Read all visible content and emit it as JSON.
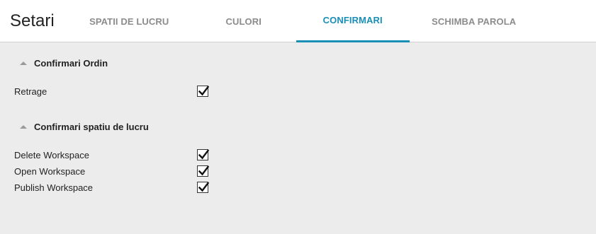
{
  "app": {
    "title": "Setari"
  },
  "tabs": [
    {
      "label": "SPATII DE LUCRU",
      "active": false
    },
    {
      "label": "CULORI",
      "active": false
    },
    {
      "label": "CONFIRMARI",
      "active": true
    },
    {
      "label": "SCHIMBA PAROLA",
      "active": false
    }
  ],
  "sections": [
    {
      "title": "Confirmari Ordin",
      "icon": "caret-up-icon",
      "items": [
        {
          "label": "Retrage",
          "checked": true
        }
      ]
    },
    {
      "title": "Confirmari spatiu de lucru",
      "icon": "caret-up-icon",
      "items": [
        {
          "label": "Delete Workspace",
          "checked": true
        },
        {
          "label": "Open Workspace",
          "checked": true
        },
        {
          "label": "Publish Workspace",
          "checked": true
        }
      ]
    }
  ],
  "colors": {
    "accent": "#1a8fb5",
    "tab_inactive": "#8c8c8c",
    "background": "#ececec"
  }
}
